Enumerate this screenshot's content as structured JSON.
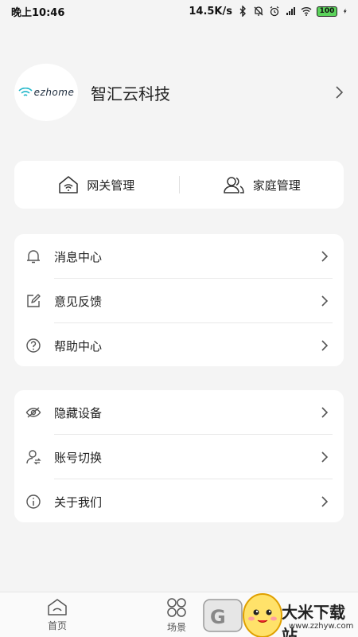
{
  "status_bar": {
    "time": "晚上10:46",
    "network_speed": "14.5K/s",
    "battery": "100"
  },
  "profile": {
    "logo_text": "ezhome",
    "name": "智汇云科技"
  },
  "quick_actions": [
    {
      "label": "网关管理",
      "icon": "house-wifi-icon"
    },
    {
      "label": "家庭管理",
      "icon": "people-icon"
    }
  ],
  "menu_group_1": [
    {
      "label": "消息中心",
      "icon": "bell-icon"
    },
    {
      "label": "意见反馈",
      "icon": "edit-icon"
    },
    {
      "label": "帮助中心",
      "icon": "question-icon"
    }
  ],
  "menu_group_2": [
    {
      "label": "隐藏设备",
      "icon": "eye-off-icon"
    },
    {
      "label": "账号切换",
      "icon": "user-switch-icon"
    },
    {
      "label": "关于我们",
      "icon": "info-icon"
    }
  ],
  "tabbar": [
    {
      "label": "首页",
      "icon": "home-icon"
    },
    {
      "label": "场景",
      "icon": "scene-icon"
    }
  ],
  "watermark": {
    "text": "大米下载站",
    "url": "www.zzhyw.com"
  },
  "colors": {
    "background": "#f4f4f4",
    "card": "#ffffff",
    "text": "#222222",
    "icon": "#555555"
  }
}
